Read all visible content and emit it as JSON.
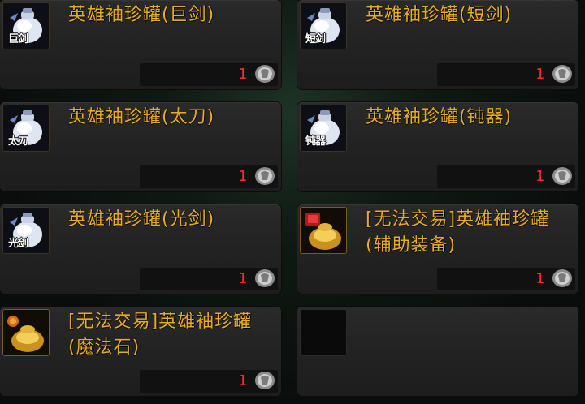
{
  "items": [
    {
      "name": "英雄袖珍罐(巨剑)",
      "tag": "巨剑",
      "qty": "1",
      "icon": "white-jar-icon"
    },
    {
      "name": "英雄袖珍罐(短剑)",
      "tag": "短剑",
      "qty": "1",
      "icon": "white-jar-icon"
    },
    {
      "name": "英雄袖珍罐(太刀)",
      "tag": "太刀",
      "qty": "1",
      "icon": "white-jar-icon"
    },
    {
      "name": "英雄袖珍罐(钝器)",
      "tag": "钝器",
      "qty": "1",
      "icon": "white-jar-icon"
    },
    {
      "name": "英雄袖珍罐(光剑)",
      "tag": "光剑",
      "qty": "1",
      "icon": "white-jar-icon"
    },
    {
      "name": "[无法交易]英雄袖珍罐(辅助装备)",
      "tag": "",
      "qty": "1",
      "icon": "gold-jar-icon"
    },
    {
      "name": "[无法交易]英雄袖珍罐(魔法石)",
      "tag": "",
      "qty": "1",
      "icon": "gold-jar-icon"
    }
  ],
  "colors": {
    "name": "#e8ad1f",
    "qty": "#ff2b2b",
    "card": "#242424"
  }
}
